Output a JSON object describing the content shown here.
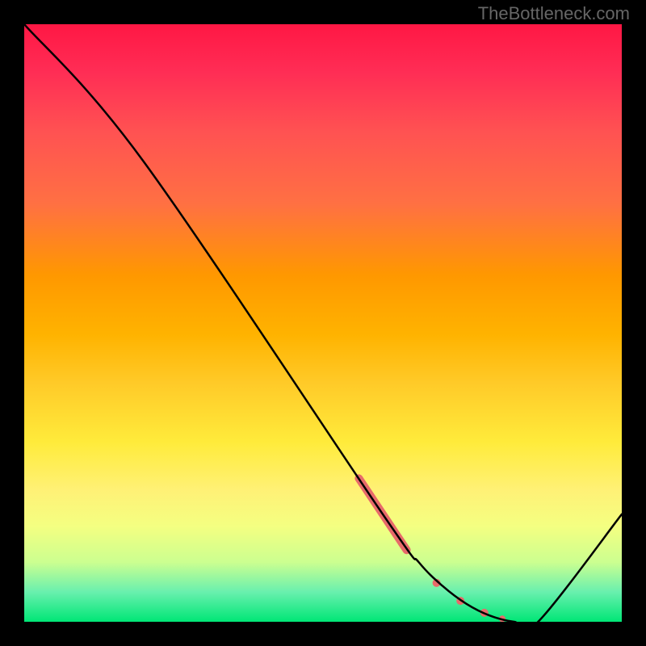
{
  "watermark": "TheBottleneck.com",
  "chart_data": {
    "type": "line",
    "title": "",
    "xlabel": "",
    "ylabel": "",
    "xlim": [
      0,
      100
    ],
    "ylim": [
      0,
      100
    ],
    "series": [
      {
        "name": "bottleneck-curve",
        "x": [
          0,
          20,
          60,
          66,
          70,
          74,
          78,
          82,
          86,
          100
        ],
        "values": [
          100,
          77,
          18,
          10,
          6,
          3,
          1,
          0,
          0,
          18
        ]
      }
    ],
    "markers": [
      {
        "name": "highlight-segment",
        "type": "segment",
        "x0": 56,
        "y0": 24,
        "x1": 64,
        "y1": 12,
        "color": "#e76a6a",
        "width": 10
      },
      {
        "name": "dot-1",
        "type": "dot",
        "x": 69,
        "y": 6.5,
        "r": 5,
        "color": "#e76a6a"
      },
      {
        "name": "dot-2",
        "type": "dot",
        "x": 73,
        "y": 3.5,
        "r": 5,
        "color": "#e76a6a"
      },
      {
        "name": "dot-3",
        "type": "dot",
        "x": 77,
        "y": 1.5,
        "r": 5,
        "color": "#e76a6a"
      },
      {
        "name": "dot-4",
        "type": "dot",
        "x": 80,
        "y": 0.5,
        "r": 4,
        "color": "#e76a6a"
      }
    ],
    "background": {
      "type": "vertical-gradient",
      "stops": [
        {
          "pos": 0,
          "color": "#ff1744"
        },
        {
          "pos": 50,
          "color": "#ffca28"
        },
        {
          "pos": 80,
          "color": "#fff176"
        },
        {
          "pos": 100,
          "color": "#00e676"
        }
      ]
    }
  }
}
